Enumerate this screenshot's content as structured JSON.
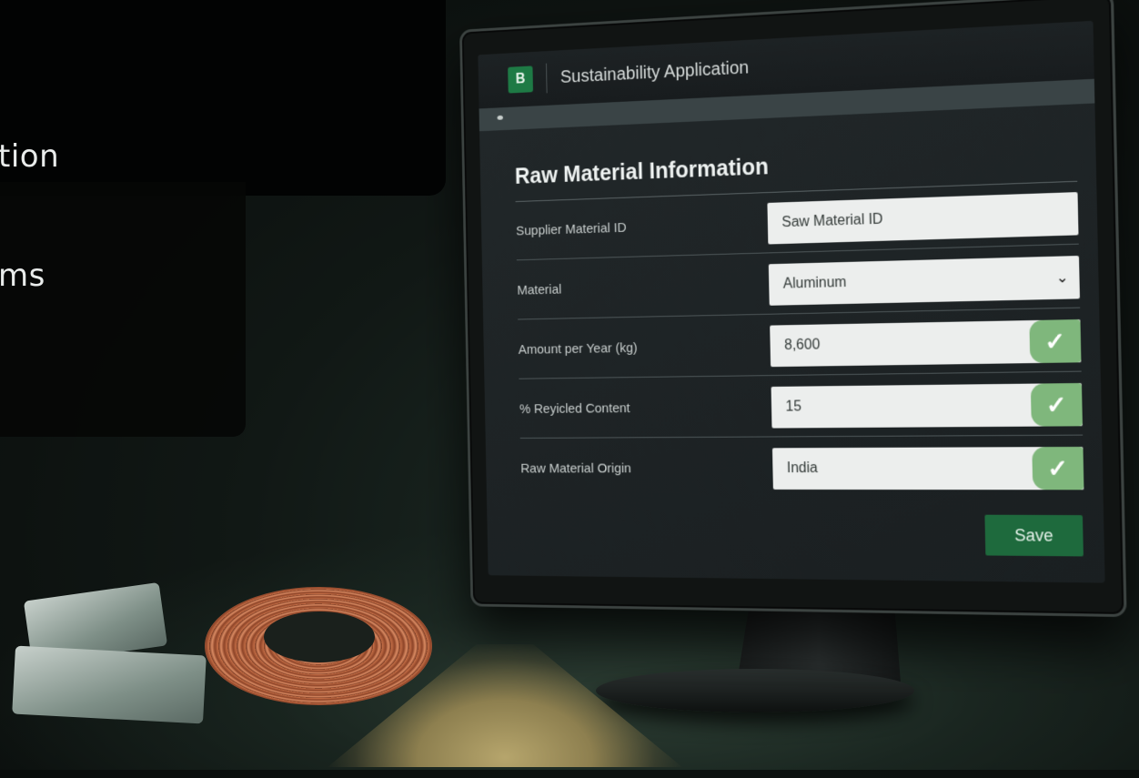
{
  "side_text": {
    "line1": "tion",
    "line2": "ms"
  },
  "app": {
    "title": "Sustainability Application",
    "logo_letter": "B"
  },
  "form": {
    "section_title": "Raw Material Information",
    "rows": [
      {
        "label": "Supplier Material ID",
        "value": "Saw Material ID",
        "control": "text"
      },
      {
        "label": "Material",
        "value": "Aluminum",
        "control": "select"
      },
      {
        "label": "Amount per Year (kg)",
        "value": "8,600",
        "control": "text-validated"
      },
      {
        "label": "% Reyicled Content",
        "value": "15",
        "control": "text-validated"
      },
      {
        "label": "Raw Material Origin",
        "value": "India",
        "control": "text-validated"
      }
    ],
    "save_label": "Save"
  },
  "icons": {
    "check": "check-icon",
    "chevron": "chevron-down-icon",
    "logo": "app-logo-icon"
  },
  "colors": {
    "accent_green": "#1e6a3d",
    "check_green": "#7fb77c"
  }
}
